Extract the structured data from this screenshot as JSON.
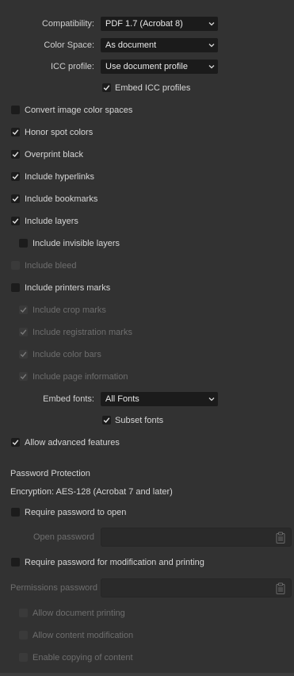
{
  "export": {
    "compatibility": {
      "label": "Compatibility:",
      "value": "PDF 1.7 (Acrobat 8)"
    },
    "color_space": {
      "label": "Color Space:",
      "value": "As document"
    },
    "icc_profile": {
      "label": "ICC profile:",
      "value": "Use document profile"
    },
    "embed_fonts": {
      "label": "Embed fonts:",
      "value": "All Fonts"
    }
  },
  "options": {
    "embed_icc": {
      "label": "Embed ICC profiles",
      "checked": true
    },
    "convert_image": {
      "label": "Convert image color spaces",
      "checked": false
    },
    "honor_spot": {
      "label": "Honor spot colors",
      "checked": true
    },
    "overprint": {
      "label": "Overprint black",
      "checked": true
    },
    "hyperlinks": {
      "label": "Include hyperlinks",
      "checked": true
    },
    "bookmarks": {
      "label": "Include bookmarks",
      "checked": true
    },
    "layers": {
      "label": "Include layers",
      "checked": true
    },
    "invisible_layers": {
      "label": "Include invisible layers",
      "checked": false
    },
    "bleed": {
      "label": "Include bleed",
      "checked": false,
      "disabled": true
    },
    "printers_marks": {
      "label": "Include printers marks",
      "checked": false
    },
    "crop_marks": {
      "label": "Include crop marks",
      "checked": true,
      "disabled": true
    },
    "registration_marks": {
      "label": "Include registration marks",
      "checked": true,
      "disabled": true
    },
    "color_bars": {
      "label": "Include color bars",
      "checked": true,
      "disabled": true
    },
    "page_info": {
      "label": "Include page information",
      "checked": true,
      "disabled": true
    },
    "subset_fonts": {
      "label": "Subset fonts",
      "checked": true
    },
    "advanced": {
      "label": "Allow advanced features",
      "checked": true
    }
  },
  "password": {
    "heading": "Password Protection",
    "encryption": "Encryption: AES-128 (Acrobat 7 and later)",
    "require_open": {
      "label": "Require password to open",
      "checked": false
    },
    "open_password_label": "Open password",
    "require_modify": {
      "label": "Require password for modification and printing",
      "checked": false
    },
    "permissions_password_label": "Permissions password",
    "allow_printing": {
      "label": "Allow document printing",
      "checked": false,
      "disabled": true
    },
    "allow_modification": {
      "label": "Allow content modification",
      "checked": false,
      "disabled": true
    },
    "enable_copying": {
      "label": "Enable copying of content",
      "checked": false,
      "disabled": true
    }
  },
  "colors": {
    "background": "#323232",
    "field": "#1b1b1b",
    "text": "#d6d6d6",
    "disabled_text": "#6e6e6e"
  }
}
